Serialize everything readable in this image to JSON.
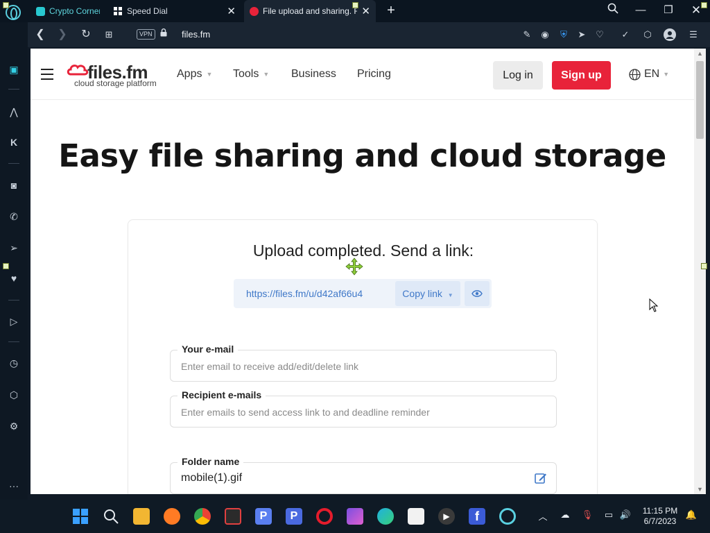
{
  "browser": {
    "tabs": [
      {
        "label": "Crypto Corner",
        "favicon": "crypto-corner-icon",
        "color": "#28c8d0"
      },
      {
        "label": "Speed Dial",
        "favicon": "speed-dial-icon",
        "color": "#ffffff"
      },
      {
        "label": "File upload and sharing. F",
        "favicon": "filesfm-icon",
        "color": "#e8233a"
      }
    ],
    "address": {
      "vpn": "VPN",
      "url": "files.fm"
    }
  },
  "site": {
    "logo_text": "files.fm",
    "logo_sub": "cloud storage platform",
    "nav": [
      "Apps",
      "Tools",
      "Business",
      "Pricing"
    ],
    "login": "Log in",
    "signup": "Sign up",
    "language": "EN"
  },
  "hero": {
    "headline": "Easy file sharing and cloud storage"
  },
  "upload": {
    "title": "Upload completed. Send a link:",
    "link_url": "https://files.fm/u/d42af66u4",
    "copy_label": "Copy link",
    "fields": {
      "email": {
        "label": "Your e-mail",
        "placeholder": "Enter email to receive add/edit/delete link"
      },
      "recipients": {
        "label": "Recipient e-mails",
        "placeholder": "Enter emails to send access link to and deadline reminder"
      },
      "folder": {
        "label": "Folder name",
        "value": "mobile(1).gif"
      }
    }
  },
  "taskbar": {
    "time": "11:15 PM",
    "date": "6/7/2023"
  },
  "colors": {
    "brand_red": "#e8233a",
    "link_blue": "#3f78c8",
    "browser_dark": "#0b1520"
  }
}
